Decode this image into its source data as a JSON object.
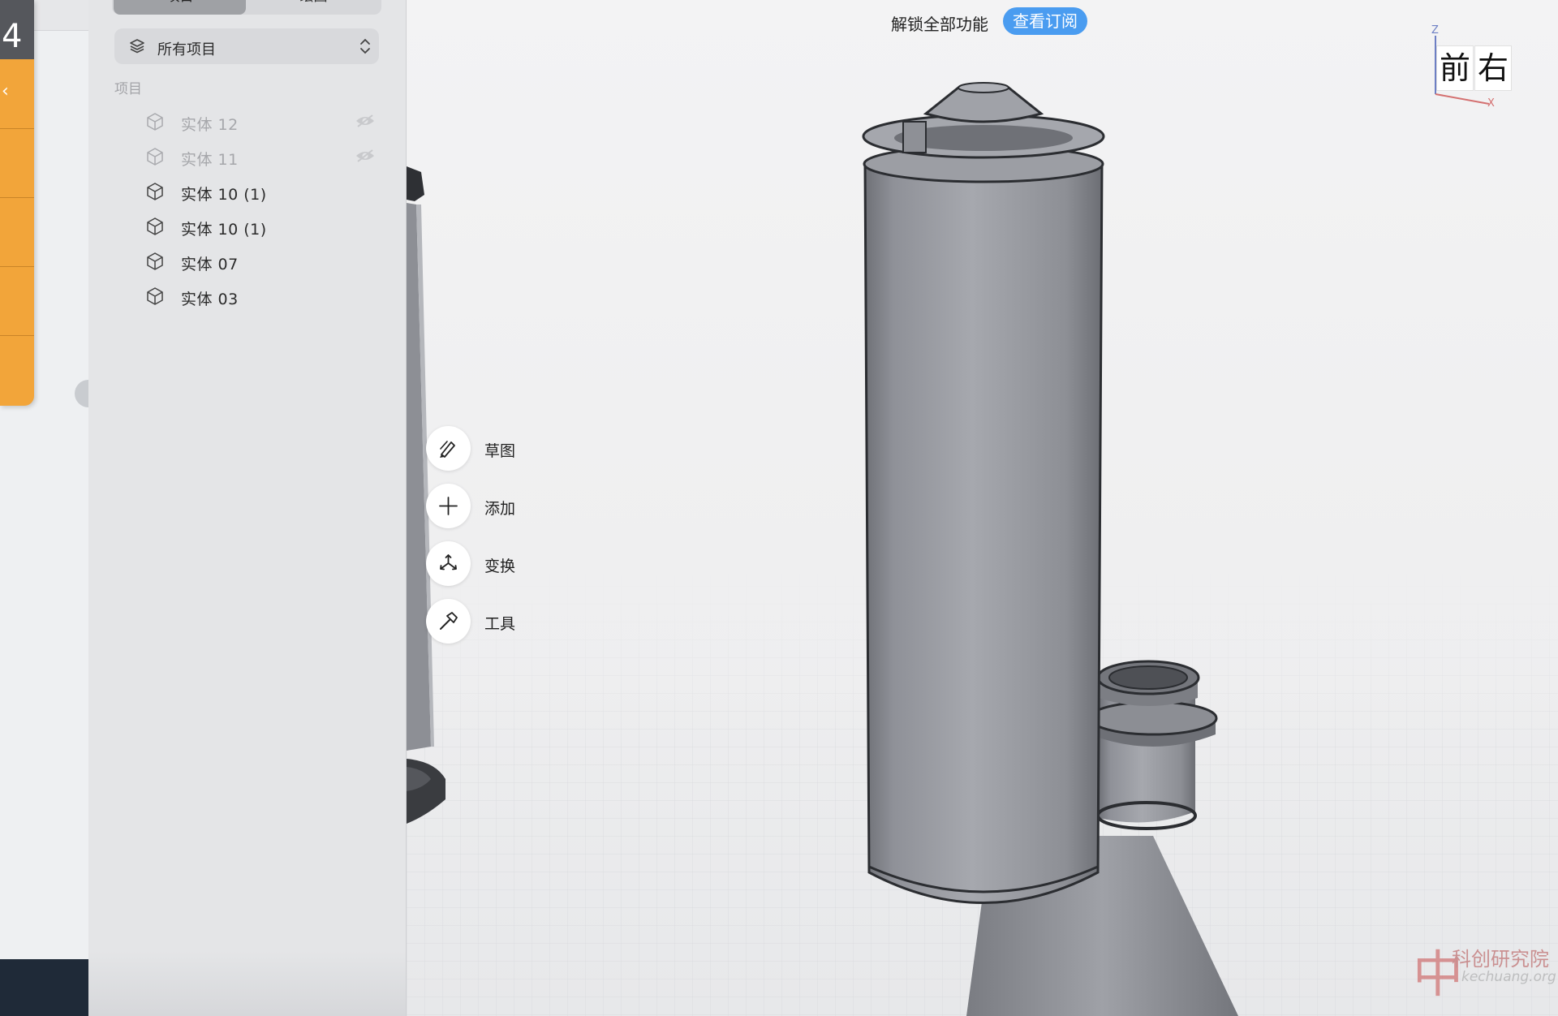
{
  "left_strip": {
    "top_digit": "4",
    "glyph": "‹"
  },
  "sidebar": {
    "tabs": [
      {
        "label": "项目",
        "active": true
      },
      {
        "label": "绘图",
        "active": false
      }
    ],
    "filter": {
      "selected": "所有项目",
      "icon": "layers-icon"
    },
    "section_label": "项目",
    "items": [
      {
        "name": "实体  12",
        "hidden": true
      },
      {
        "name": "实体  11",
        "hidden": true
      },
      {
        "name": "实体  10 (1)",
        "hidden": false
      },
      {
        "name": "实体  10 (1)",
        "hidden": false
      },
      {
        "name": "实体  07",
        "hidden": false
      },
      {
        "name": "实体  03",
        "hidden": false
      }
    ]
  },
  "viewport": {
    "unlock_banner": {
      "text": "解锁全部功能",
      "button": "查看订阅"
    },
    "tools": [
      {
        "label": "草图",
        "icon": "sketch-pen-icon"
      },
      {
        "label": "添加",
        "icon": "plus-icon"
      },
      {
        "label": "变换",
        "icon": "transform-arrows-icon"
      },
      {
        "label": "工具",
        "icon": "hammer-icon"
      }
    ],
    "view_cube": {
      "axis_z": "Z",
      "axis_x": "X",
      "front": "前",
      "right": "右"
    },
    "watermark": {
      "logo": "中",
      "brand": "科创研究院",
      "site": "kechuang.org"
    }
  },
  "colors": {
    "accent_blue": "#4a9cf0",
    "orange_panel": "#f2a53a",
    "model_gray": "#9a9ca3"
  }
}
